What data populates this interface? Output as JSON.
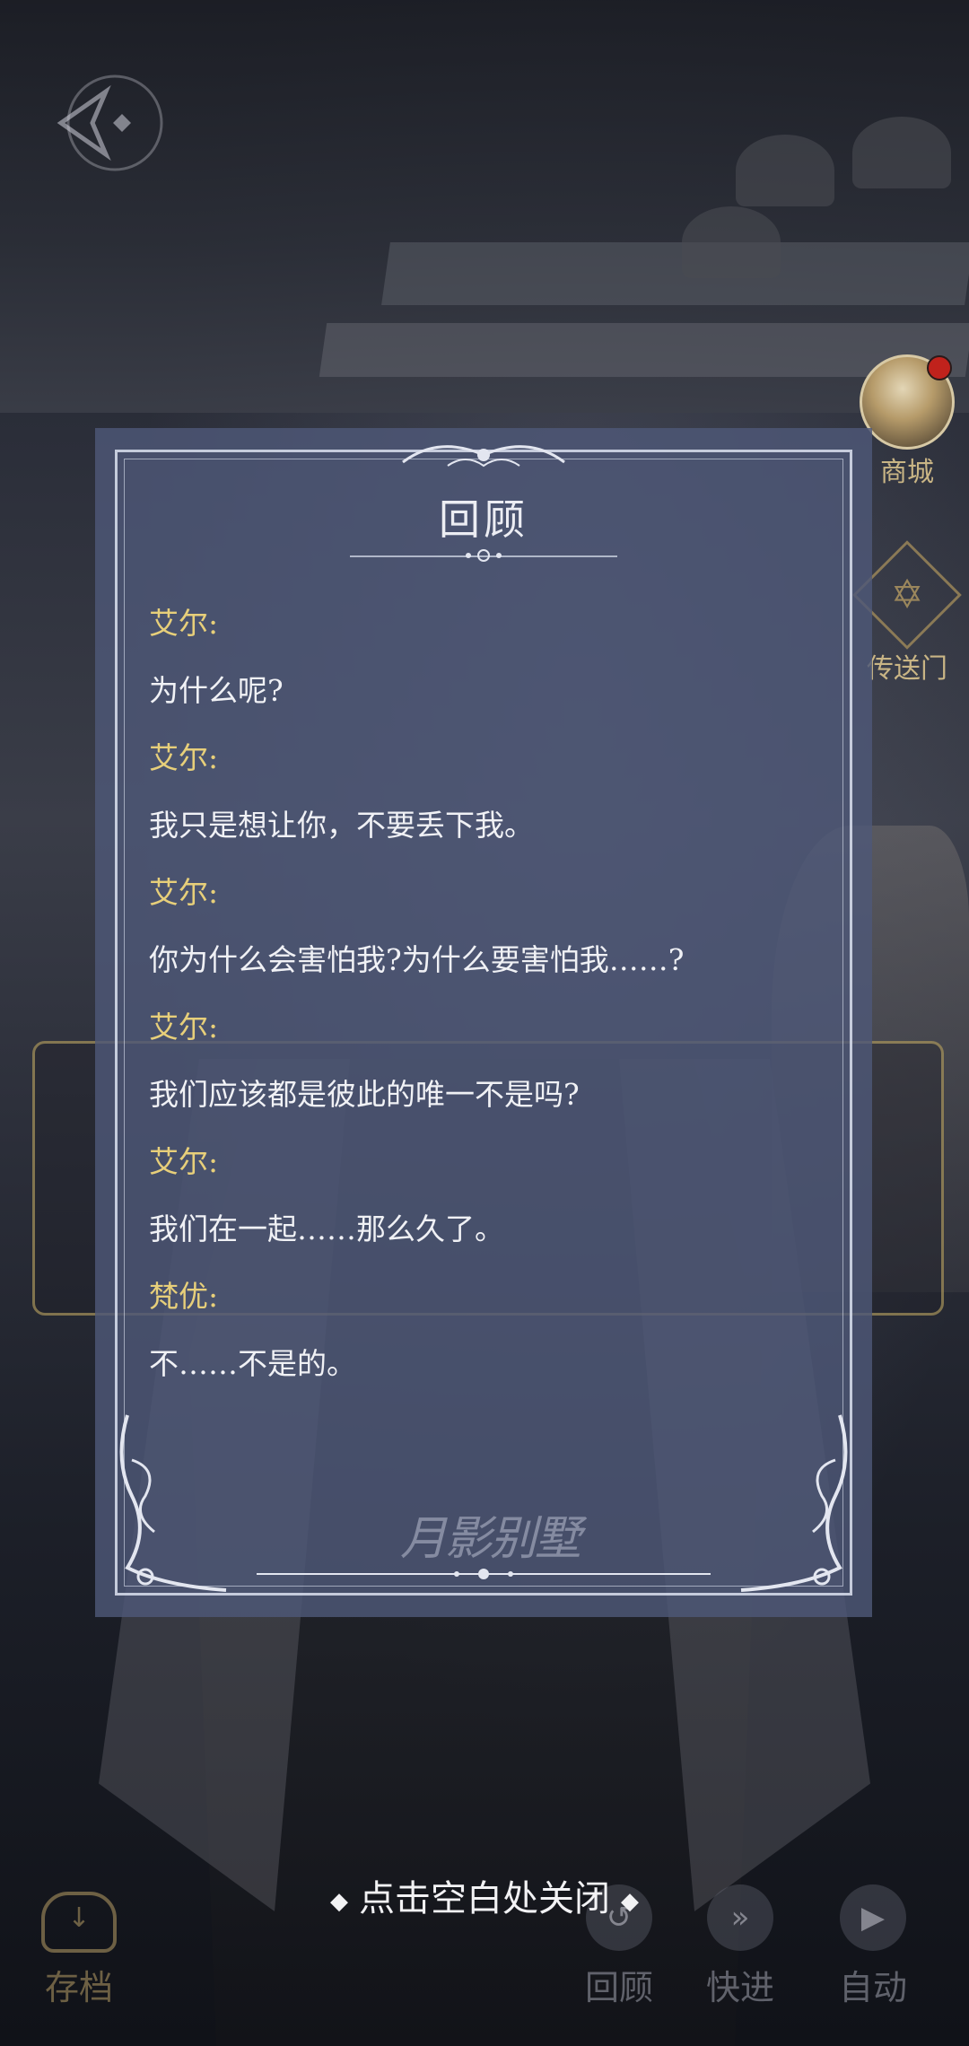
{
  "modal": {
    "title": "回顾",
    "entries": [
      {
        "speaker": "艾尔:",
        "line": "为什么呢?"
      },
      {
        "speaker": "艾尔:",
        "line": "我只是想让你，不要丢下我。"
      },
      {
        "speaker": "艾尔:",
        "line": "你为什么会害怕我?为什么要害怕我……?"
      },
      {
        "speaker": "艾尔:",
        "line": "我们应该都是彼此的唯一不是吗?"
      },
      {
        "speaker": "艾尔:",
        "line": "我们在一起……那么久了。"
      },
      {
        "speaker": "梵优:",
        "line": "不……不是的。"
      }
    ],
    "watermark": "月影别墅"
  },
  "close_hint": "点击空白处关闭",
  "side_menu": {
    "shop_label": "商城",
    "portal_label": "传送门"
  },
  "toolbar": {
    "save_label": "存档",
    "review_label": "回顾",
    "fast_label": "快进",
    "auto_label": "自动"
  },
  "colors": {
    "speaker": "#e7cf7a",
    "modal_bg": "#4e5878",
    "gold": "#c9b585",
    "notification": "#c0221c"
  },
  "icons": [
    "back-arrow-icon",
    "shop-avatar-icon",
    "portal-icon",
    "save-icon",
    "review-icon",
    "fast-forward-icon",
    "auto-play-icon",
    "diamond-icon"
  ]
}
